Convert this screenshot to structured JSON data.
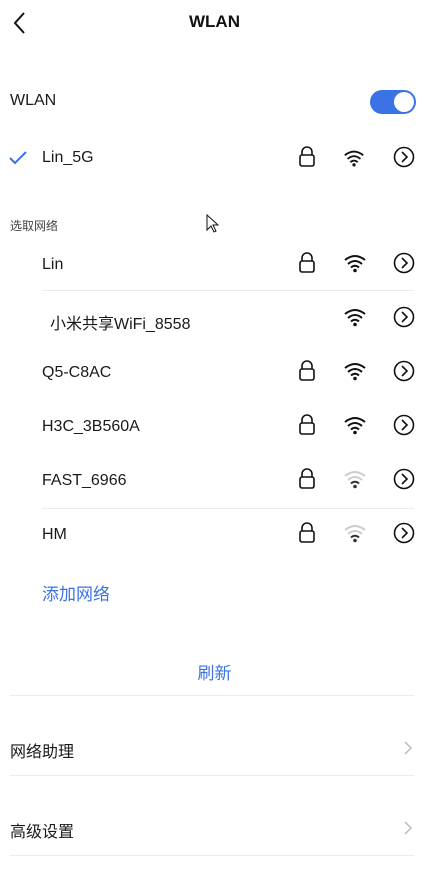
{
  "header": {
    "title": "WLAN"
  },
  "wlan_toggle": {
    "label": "WLAN",
    "state": "on"
  },
  "connected": {
    "ssid": "Lin_5G",
    "secured": true,
    "signal": "strong"
  },
  "section_title": "选取网络",
  "networks": [
    {
      "ssid": "Lin",
      "secured": true,
      "signal": "strong"
    },
    {
      "ssid": "小米共享WiFi_8558",
      "secured": false,
      "signal": "strong"
    },
    {
      "ssid": "Q5-C8AC",
      "secured": true,
      "signal": "strong"
    },
    {
      "ssid": "H3C_3B560A",
      "secured": true,
      "signal": "strong"
    },
    {
      "ssid": "FAST_6966",
      "secured": true,
      "signal": "weak"
    },
    {
      "ssid": "HM",
      "secured": true,
      "signal": "weak"
    }
  ],
  "add_network": "添加网络",
  "refresh": "刷新",
  "menu": [
    {
      "label": "网络助理"
    },
    {
      "label": "高级设置"
    }
  ],
  "colors": {
    "accent": "#3b73e6",
    "weak_signal": "#cccccc",
    "strong_signal": "#111111"
  }
}
